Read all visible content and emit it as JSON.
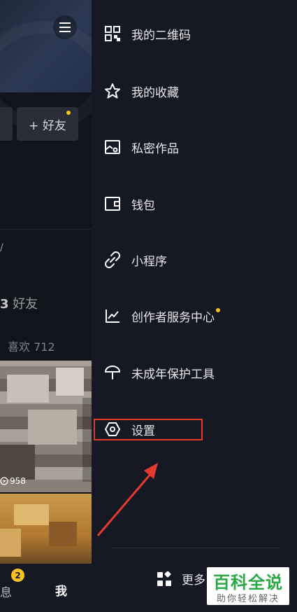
{
  "profile": {
    "add_friend": "+ 好友",
    "friends_count": "3",
    "friends_label": "好友",
    "likes": "喜欢 712",
    "views": "958",
    "nav_messages": "息",
    "nav_badge": "2",
    "nav_me": "我"
  },
  "drawer": {
    "items": [
      {
        "label": "我的二维码",
        "icon": "qr-code-icon"
      },
      {
        "label": "我的收藏",
        "icon": "star-icon"
      },
      {
        "label": "私密作品",
        "icon": "private-works-icon"
      },
      {
        "label": "钱包",
        "icon": "wallet-icon"
      },
      {
        "label": "小程序",
        "icon": "mini-program-icon"
      },
      {
        "label": "创作者服务中心",
        "icon": "chart-icon"
      },
      {
        "label": "未成年保护工具",
        "icon": "umbrella-icon"
      },
      {
        "label": "设置",
        "icon": "settings-icon"
      }
    ],
    "more_label": "更多",
    "more_icon": "apps-icon"
  },
  "watermark": {
    "title": "百科全说",
    "subtitle": "助你轻松解决"
  },
  "colors": {
    "background": "#161823",
    "highlight": "#e23b2e",
    "notify_dot": "#f8c31f",
    "watermark_green": "#2aa845"
  }
}
